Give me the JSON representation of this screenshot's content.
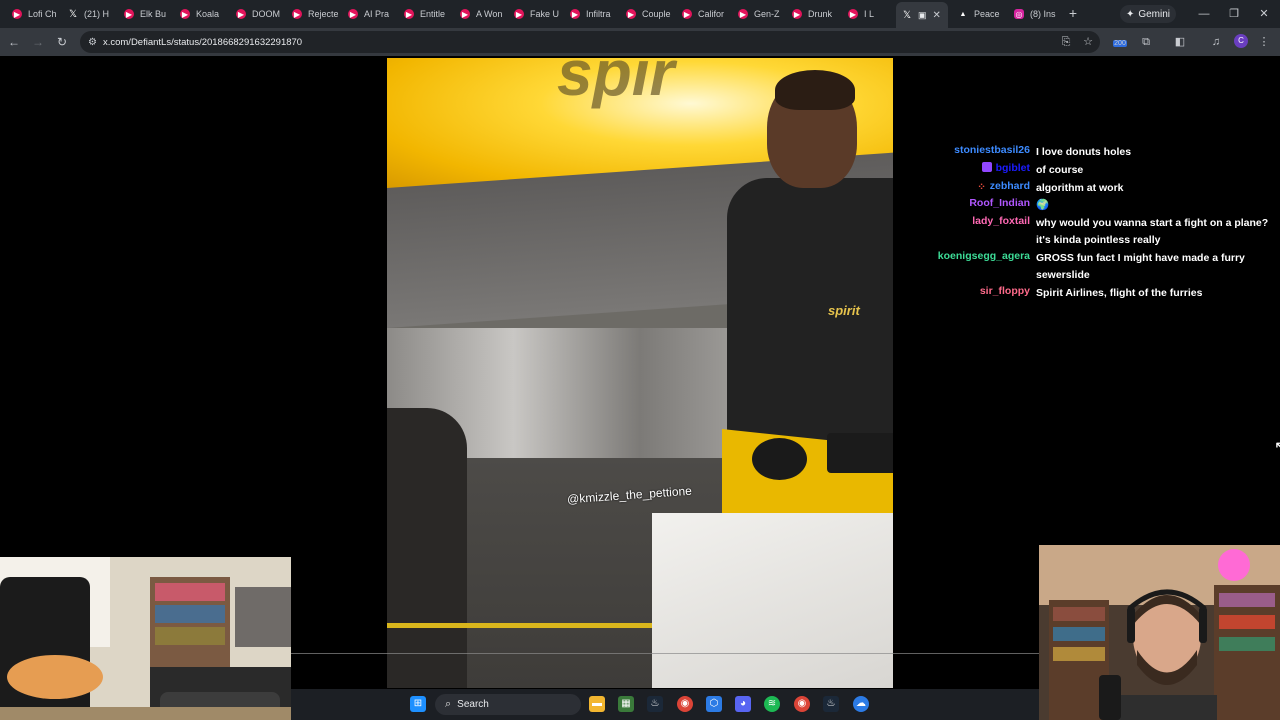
{
  "tabs": [
    {
      "label": "Lofi Ch",
      "icon": "youtube-icon",
      "color": "#e2145b"
    },
    {
      "label": "(21) H",
      "icon": "x-icon",
      "color": "#ffffff"
    },
    {
      "label": "Elk Bu",
      "icon": "youtube-icon",
      "color": "#e2145b"
    },
    {
      "label": "Koala",
      "icon": "youtube-icon",
      "color": "#e2145b"
    },
    {
      "label": "DOOM",
      "icon": "youtube-icon",
      "color": "#e2145b"
    },
    {
      "label": "Rejecte",
      "icon": "youtube-icon",
      "color": "#e2145b"
    },
    {
      "label": "AI Pra",
      "icon": "youtube-icon",
      "color": "#e2145b"
    },
    {
      "label": "Entitle",
      "icon": "youtube-icon",
      "color": "#e2145b"
    },
    {
      "label": "A Won",
      "icon": "youtube-icon",
      "color": "#e2145b"
    },
    {
      "label": "Fake U",
      "icon": "youtube-icon",
      "color": "#e2145b"
    },
    {
      "label": "Infiltra",
      "icon": "youtube-icon",
      "color": "#e2145b"
    },
    {
      "label": "Couple",
      "icon": "youtube-icon",
      "color": "#e2145b"
    },
    {
      "label": "Califor",
      "icon": "youtube-icon",
      "color": "#e2145b"
    },
    {
      "label": "Gen-Z",
      "icon": "youtube-icon",
      "color": "#e2145b"
    },
    {
      "label": "Drunk",
      "icon": "youtube-icon",
      "color": "#e2145b"
    },
    {
      "label": "I L",
      "icon": "youtube-icon",
      "color": "#e2145b"
    },
    {
      "label": "",
      "icon": "x-icon",
      "color": "#ffffff",
      "active": true
    },
    {
      "label": "Peace",
      "icon": "triangle-icon",
      "color": "#ffffff"
    },
    {
      "label": "(8) Ins",
      "icon": "instagram-icon",
      "color": "#d6249f"
    }
  ],
  "gemini_label": "Gemini",
  "url": "x.com/DefiantLs/status/2018668291632291870",
  "extensions_badge": "200",
  "profile_initial": "C",
  "video": {
    "shirt_logo": "spirit",
    "watermark": "@kmizzle_the_pettione"
  },
  "chat": [
    {
      "user": "stoniestbasil26",
      "text": "I love donuts holes",
      "color": "#3d8bff",
      "badge": ""
    },
    {
      "user": "bgiblet",
      "text": "of course",
      "color": "#1c1cff",
      "badge": "purple"
    },
    {
      "user": "zebhard",
      "text": "algorithm at work",
      "color": "#3d8bff",
      "badge": "red"
    },
    {
      "user": "Roof_Indian",
      "text": "🌍",
      "color": "#b157ff",
      "badge": ""
    },
    {
      "user": "lady_foxtail",
      "text": "why would you wanna start a fight on a plane? it's kinda pointless really",
      "color": "#ff69b4",
      "badge": ""
    },
    {
      "user": "koenigsegg_agera",
      "text": "GROSS fun fact I might have made a furry sewerslide",
      "color": "#3ddc97",
      "badge": ""
    },
    {
      "user": "sir_floppy",
      "text": "Spirit Airlines, flight of the furries",
      "color": "#ff6b8b",
      "badge": ""
    }
  ],
  "taskbar": {
    "search_label": "Search",
    "apps": [
      "windows-start-icon",
      "file-explorer-icon",
      "app-icon",
      "steam-icon",
      "chrome-icon",
      "app-icon",
      "discord-icon",
      "spotify-icon",
      "chrome-icon",
      "steam-icon",
      "chat-icon"
    ]
  }
}
